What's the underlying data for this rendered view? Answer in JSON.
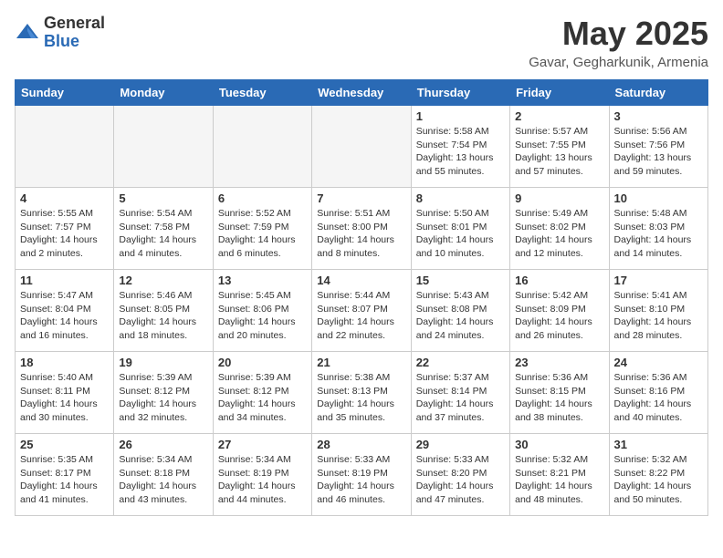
{
  "header": {
    "logo_general": "General",
    "logo_blue": "Blue",
    "month_title": "May 2025",
    "location": "Gavar, Gegharkunik, Armenia"
  },
  "days_of_week": [
    "Sunday",
    "Monday",
    "Tuesday",
    "Wednesday",
    "Thursday",
    "Friday",
    "Saturday"
  ],
  "weeks": [
    [
      {
        "day": "",
        "info": "",
        "empty": true
      },
      {
        "day": "",
        "info": "",
        "empty": true
      },
      {
        "day": "",
        "info": "",
        "empty": true
      },
      {
        "day": "",
        "info": "",
        "empty": true
      },
      {
        "day": "1",
        "info": "Sunrise: 5:58 AM\nSunset: 7:54 PM\nDaylight: 13 hours\nand 55 minutes."
      },
      {
        "day": "2",
        "info": "Sunrise: 5:57 AM\nSunset: 7:55 PM\nDaylight: 13 hours\nand 57 minutes."
      },
      {
        "day": "3",
        "info": "Sunrise: 5:56 AM\nSunset: 7:56 PM\nDaylight: 13 hours\nand 59 minutes."
      }
    ],
    [
      {
        "day": "4",
        "info": "Sunrise: 5:55 AM\nSunset: 7:57 PM\nDaylight: 14 hours\nand 2 minutes."
      },
      {
        "day": "5",
        "info": "Sunrise: 5:54 AM\nSunset: 7:58 PM\nDaylight: 14 hours\nand 4 minutes."
      },
      {
        "day": "6",
        "info": "Sunrise: 5:52 AM\nSunset: 7:59 PM\nDaylight: 14 hours\nand 6 minutes."
      },
      {
        "day": "7",
        "info": "Sunrise: 5:51 AM\nSunset: 8:00 PM\nDaylight: 14 hours\nand 8 minutes."
      },
      {
        "day": "8",
        "info": "Sunrise: 5:50 AM\nSunset: 8:01 PM\nDaylight: 14 hours\nand 10 minutes."
      },
      {
        "day": "9",
        "info": "Sunrise: 5:49 AM\nSunset: 8:02 PM\nDaylight: 14 hours\nand 12 minutes."
      },
      {
        "day": "10",
        "info": "Sunrise: 5:48 AM\nSunset: 8:03 PM\nDaylight: 14 hours\nand 14 minutes."
      }
    ],
    [
      {
        "day": "11",
        "info": "Sunrise: 5:47 AM\nSunset: 8:04 PM\nDaylight: 14 hours\nand 16 minutes."
      },
      {
        "day": "12",
        "info": "Sunrise: 5:46 AM\nSunset: 8:05 PM\nDaylight: 14 hours\nand 18 minutes."
      },
      {
        "day": "13",
        "info": "Sunrise: 5:45 AM\nSunset: 8:06 PM\nDaylight: 14 hours\nand 20 minutes."
      },
      {
        "day": "14",
        "info": "Sunrise: 5:44 AM\nSunset: 8:07 PM\nDaylight: 14 hours\nand 22 minutes."
      },
      {
        "day": "15",
        "info": "Sunrise: 5:43 AM\nSunset: 8:08 PM\nDaylight: 14 hours\nand 24 minutes."
      },
      {
        "day": "16",
        "info": "Sunrise: 5:42 AM\nSunset: 8:09 PM\nDaylight: 14 hours\nand 26 minutes."
      },
      {
        "day": "17",
        "info": "Sunrise: 5:41 AM\nSunset: 8:10 PM\nDaylight: 14 hours\nand 28 minutes."
      }
    ],
    [
      {
        "day": "18",
        "info": "Sunrise: 5:40 AM\nSunset: 8:11 PM\nDaylight: 14 hours\nand 30 minutes."
      },
      {
        "day": "19",
        "info": "Sunrise: 5:39 AM\nSunset: 8:12 PM\nDaylight: 14 hours\nand 32 minutes."
      },
      {
        "day": "20",
        "info": "Sunrise: 5:39 AM\nSunset: 8:12 PM\nDaylight: 14 hours\nand 34 minutes."
      },
      {
        "day": "21",
        "info": "Sunrise: 5:38 AM\nSunset: 8:13 PM\nDaylight: 14 hours\nand 35 minutes."
      },
      {
        "day": "22",
        "info": "Sunrise: 5:37 AM\nSunset: 8:14 PM\nDaylight: 14 hours\nand 37 minutes."
      },
      {
        "day": "23",
        "info": "Sunrise: 5:36 AM\nSunset: 8:15 PM\nDaylight: 14 hours\nand 38 minutes."
      },
      {
        "day": "24",
        "info": "Sunrise: 5:36 AM\nSunset: 8:16 PM\nDaylight: 14 hours\nand 40 minutes."
      }
    ],
    [
      {
        "day": "25",
        "info": "Sunrise: 5:35 AM\nSunset: 8:17 PM\nDaylight: 14 hours\nand 41 minutes."
      },
      {
        "day": "26",
        "info": "Sunrise: 5:34 AM\nSunset: 8:18 PM\nDaylight: 14 hours\nand 43 minutes."
      },
      {
        "day": "27",
        "info": "Sunrise: 5:34 AM\nSunset: 8:19 PM\nDaylight: 14 hours\nand 44 minutes."
      },
      {
        "day": "28",
        "info": "Sunrise: 5:33 AM\nSunset: 8:19 PM\nDaylight: 14 hours\nand 46 minutes."
      },
      {
        "day": "29",
        "info": "Sunrise: 5:33 AM\nSunset: 8:20 PM\nDaylight: 14 hours\nand 47 minutes."
      },
      {
        "day": "30",
        "info": "Sunrise: 5:32 AM\nSunset: 8:21 PM\nDaylight: 14 hours\nand 48 minutes."
      },
      {
        "day": "31",
        "info": "Sunrise: 5:32 AM\nSunset: 8:22 PM\nDaylight: 14 hours\nand 50 minutes."
      }
    ]
  ]
}
